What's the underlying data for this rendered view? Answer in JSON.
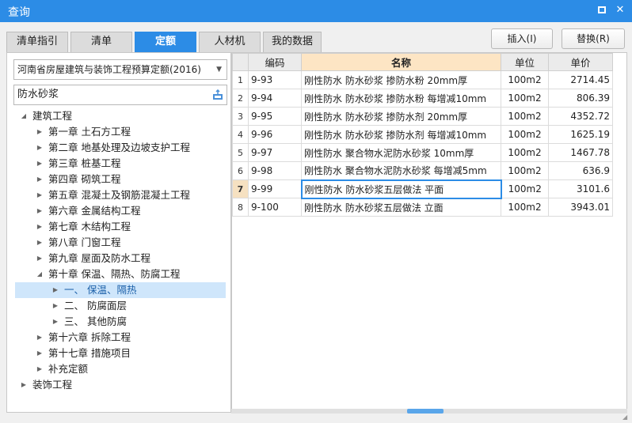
{
  "window": {
    "title": "查询"
  },
  "tabs": [
    "清单指引",
    "清单",
    "定额",
    "人材机",
    "我的数据"
  ],
  "active_tab": 2,
  "buttons": {
    "insert": "插入(I)",
    "replace": "替换(R)"
  },
  "left": {
    "combo_value": "河南省房屋建筑与装饰工程预算定额(2016)",
    "search_value": "防水砂浆",
    "tree": [
      {
        "label": "建筑工程",
        "expander": "expanded"
      },
      {
        "label": "第一章 土石方工程",
        "expander": "collapsed"
      },
      {
        "label": "第二章 地基处理及边坡支护工程",
        "expander": "collapsed"
      },
      {
        "label": "第三章 桩基工程",
        "expander": "collapsed"
      },
      {
        "label": "第四章 砌筑工程",
        "expander": "collapsed"
      },
      {
        "label": "第五章 混凝土及钢筋混凝土工程",
        "expander": "collapsed"
      },
      {
        "label": "第六章 金属结构工程",
        "expander": "collapsed"
      },
      {
        "label": "第七章 木结构工程",
        "expander": "collapsed"
      },
      {
        "label": "第八章 门窗工程",
        "expander": "collapsed"
      },
      {
        "label": "第九章 屋面及防水工程",
        "expander": "collapsed"
      },
      {
        "label": "第十章 保温、隔热、防腐工程",
        "expander": "expanded"
      },
      {
        "label": "一、 保温、隔热",
        "expander": "collapsed",
        "selected": true
      },
      {
        "label": "二、 防腐面层",
        "expander": "collapsed"
      },
      {
        "label": "三、 其他防腐",
        "expander": "collapsed"
      },
      {
        "label": "第十六章 拆除工程",
        "expander": "collapsed"
      },
      {
        "label": "第十七章 措施项目",
        "expander": "collapsed"
      },
      {
        "label": "补充定额",
        "expander": "collapsed"
      },
      {
        "label": "装饰工程",
        "expander": "collapsed"
      }
    ]
  },
  "table": {
    "headers": [
      "",
      "编码",
      "名称",
      "单位",
      "单价"
    ],
    "rows": [
      {
        "n": "1",
        "code": "9-93",
        "name": "刚性防水 防水砂浆 掺防水粉 20mm厚",
        "unit": "100m2",
        "price": "2714.45"
      },
      {
        "n": "2",
        "code": "9-94",
        "name": "刚性防水 防水砂浆 掺防水粉 每增减10mm",
        "unit": "100m2",
        "price": "806.39"
      },
      {
        "n": "3",
        "code": "9-95",
        "name": "刚性防水 防水砂浆 掺防水剂 20mm厚",
        "unit": "100m2",
        "price": "4352.72"
      },
      {
        "n": "4",
        "code": "9-96",
        "name": "刚性防水 防水砂浆 掺防水剂 每增减10mm",
        "unit": "100m2",
        "price": "1625.19"
      },
      {
        "n": "5",
        "code": "9-97",
        "name": "刚性防水 聚合物水泥防水砂浆 10mm厚",
        "unit": "100m2",
        "price": "1467.78"
      },
      {
        "n": "6",
        "code": "9-98",
        "name": "刚性防水 聚合物水泥防水砂浆 每增减5mm",
        "unit": "100m2",
        "price": "636.9"
      },
      {
        "n": "7",
        "code": "9-99",
        "name": "刚性防水 防水砂浆五层做法 平面",
        "unit": "100m2",
        "price": "3101.6",
        "current": true
      },
      {
        "n": "8",
        "code": "9-100",
        "name": "刚性防水 防水砂浆五层做法 立面",
        "unit": "100m2",
        "price": "3943.01"
      }
    ]
  },
  "colors": {
    "accent": "#2c8ce6",
    "header_highlight": "#fde5c4",
    "selection": "#cfe6fb"
  }
}
